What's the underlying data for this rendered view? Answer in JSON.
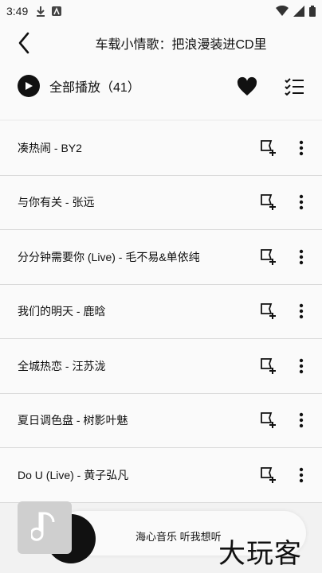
{
  "status": {
    "time": "3:49"
  },
  "header": {
    "title": "车载小情歌：把浪漫装进CD里",
    "play_all_label": "全部播放（41）"
  },
  "songs": [
    {
      "text": "凑热闹 - BY2"
    },
    {
      "text": "与你有关 - 张远"
    },
    {
      "text": "分分钟需要你 (Live) - 毛不易&单依纯"
    },
    {
      "text": "我们的明天 - 鹿晗"
    },
    {
      "text": "全城热恋 - 汪苏泷"
    },
    {
      "text": "夏日调色盘 - 树影叶魅"
    },
    {
      "text": "Do U (Live) - 黄子弘凡"
    }
  ],
  "mini_player": {
    "text": "海心音乐 听我想听"
  },
  "watermark": "大玩客",
  "icons": {
    "back": "back-arrow-icon",
    "play": "play-icon",
    "heart": "heart-icon",
    "multi_select": "checklist-icon",
    "add_to_playlist": "add-to-playlist-icon",
    "more": "more-vertical-icon"
  }
}
